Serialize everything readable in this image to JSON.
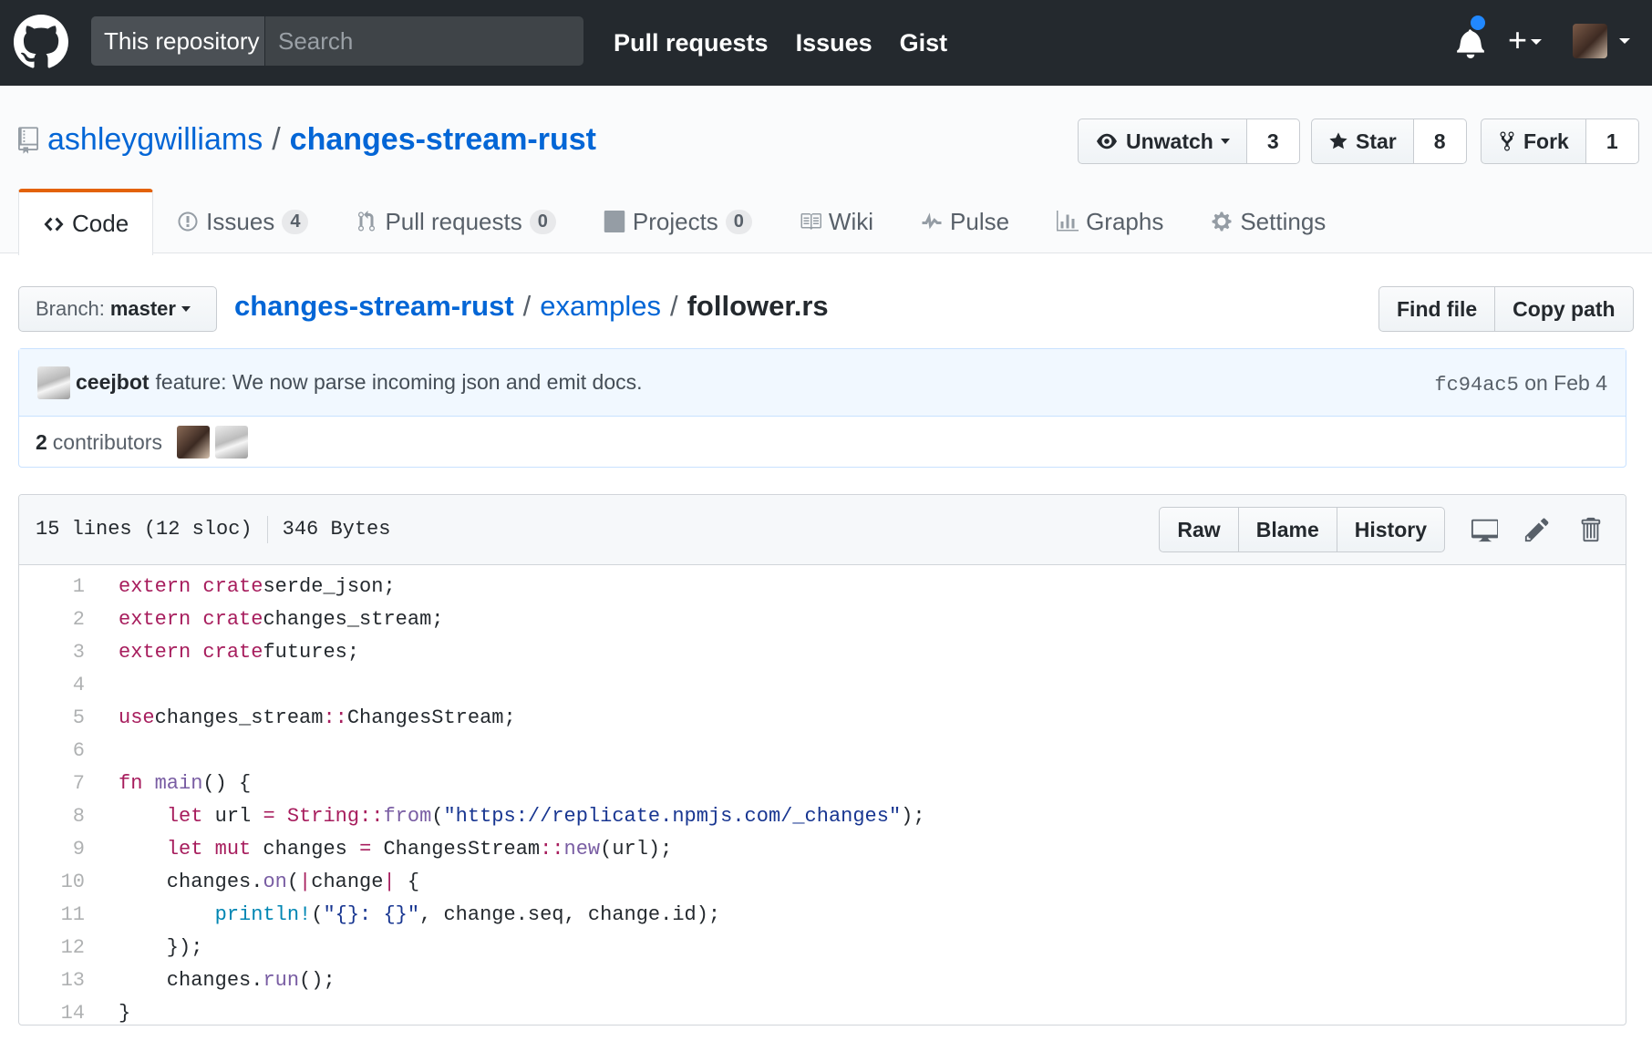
{
  "header": {
    "scope_label": "This repository",
    "search_placeholder": "Search",
    "nav": [
      "Pull requests",
      "Issues",
      "Gist"
    ]
  },
  "repo": {
    "owner": "ashleygwilliams",
    "separator": "/",
    "name": "changes-stream-rust",
    "watch": {
      "label": "Unwatch",
      "count": "3"
    },
    "star": {
      "label": "Star",
      "count": "8"
    },
    "fork": {
      "label": "Fork",
      "count": "1"
    }
  },
  "tabs": [
    {
      "label": "Code",
      "icon": "code-icon",
      "counter": null,
      "selected": true
    },
    {
      "label": "Issues",
      "icon": "issue-opened-icon",
      "counter": "4"
    },
    {
      "label": "Pull requests",
      "icon": "git-pull-request-icon",
      "counter": "0"
    },
    {
      "label": "Projects",
      "icon": "project-icon",
      "counter": "0"
    },
    {
      "label": "Wiki",
      "icon": "book-icon",
      "counter": null
    },
    {
      "label": "Pulse",
      "icon": "pulse-icon",
      "counter": null
    },
    {
      "label": "Graphs",
      "icon": "graph-icon",
      "counter": null
    },
    {
      "label": "Settings",
      "icon": "gear-icon",
      "counter": null
    }
  ],
  "file_nav": {
    "branch_prefix": "Branch:",
    "branch": "master",
    "path_root": "changes-stream-rust",
    "path_dir": "examples",
    "path_file": "follower.rs",
    "find_file": "Find file",
    "copy_path": "Copy path"
  },
  "commit": {
    "author": "ceejbot",
    "message": "feature: We now parse incoming json and emit docs.",
    "sha": "fc94ac5",
    "date": "on Feb 4",
    "contributors_count": "2",
    "contributors_label": "contributors"
  },
  "file": {
    "lines_info": "15 lines (12 sloc)",
    "size": "346 Bytes",
    "raw": "Raw",
    "blame": "Blame",
    "history": "History"
  },
  "code_lines": [
    [
      [
        "kw",
        "extern crate"
      ],
      [
        "",
        "serde_json;"
      ]
    ],
    [
      [
        "kw",
        "extern crate"
      ],
      [
        "",
        "changes_stream;"
      ]
    ],
    [
      [
        "kw",
        "extern crate"
      ],
      [
        "",
        "futures;"
      ]
    ],
    [],
    [
      [
        "kw",
        "use"
      ],
      [
        "",
        "changes_stream"
      ],
      [
        "kw",
        "::"
      ],
      [
        "",
        "ChangesStream;"
      ]
    ],
    [],
    [
      [
        "kw",
        "fn"
      ],
      [
        "",
        " "
      ],
      [
        "fn",
        "main"
      ],
      [
        "",
        "() {"
      ]
    ],
    [
      [
        "",
        "    "
      ],
      [
        "kw",
        "let"
      ],
      [
        "",
        " url "
      ],
      [
        "kw",
        "="
      ],
      [
        "",
        " "
      ],
      [
        "kw",
        "String"
      ],
      [
        "kw",
        "::"
      ],
      [
        "fn",
        "from"
      ],
      [
        "",
        "("
      ],
      [
        "str",
        "\"https://replicate.npmjs.com/_changes\""
      ],
      [
        "",
        ");"
      ]
    ],
    [
      [
        "",
        "    "
      ],
      [
        "kw",
        "let mut"
      ],
      [
        "",
        " changes "
      ],
      [
        "kw",
        "="
      ],
      [
        "",
        " ChangesStream"
      ],
      [
        "kw",
        "::"
      ],
      [
        "fn",
        "new"
      ],
      [
        "",
        "(url);"
      ]
    ],
    [
      [
        "",
        "    changes."
      ],
      [
        "fn",
        "on"
      ],
      [
        "",
        "("
      ],
      [
        "kw",
        "|"
      ],
      [
        "",
        "change"
      ],
      [
        "kw",
        "|"
      ],
      [
        "",
        " {"
      ]
    ],
    [
      [
        "",
        "        "
      ],
      [
        "mac",
        "println!"
      ],
      [
        "",
        "("
      ],
      [
        "str",
        "\"{}: {}\""
      ],
      [
        "",
        ", change.seq, change.id);"
      ]
    ],
    [
      [
        "",
        "    });"
      ]
    ],
    [
      [
        "",
        "    changes."
      ],
      [
        "fn",
        "run"
      ],
      [
        "",
        "();"
      ]
    ],
    [
      [
        "",
        "}"
      ]
    ]
  ]
}
